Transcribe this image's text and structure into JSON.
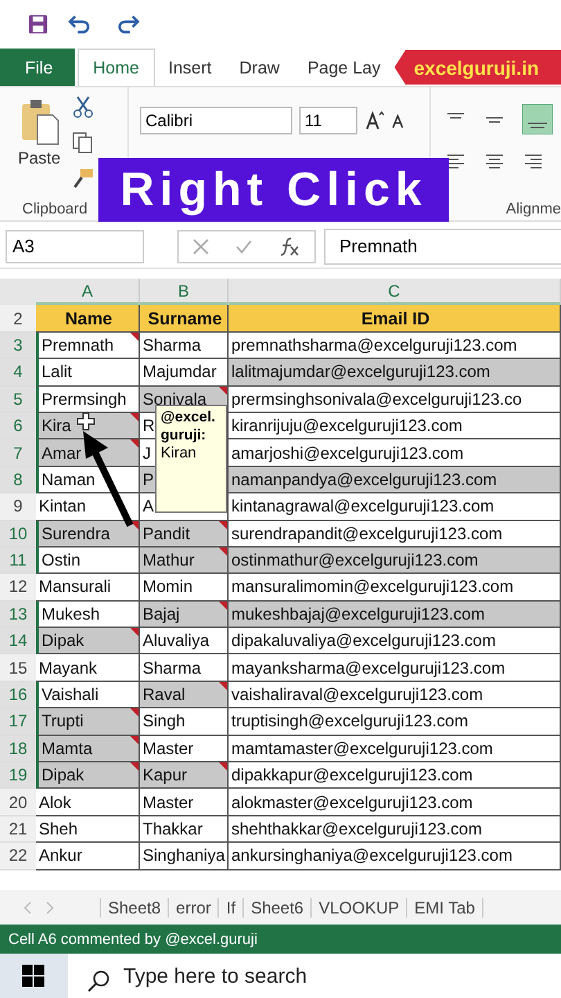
{
  "ribbon_tabs": [
    {
      "label": "File",
      "kind": "file",
      "selected": false
    },
    {
      "label": "Home",
      "kind": "tab",
      "selected": true
    },
    {
      "label": "Insert",
      "kind": "tab",
      "selected": false
    },
    {
      "label": "Draw",
      "kind": "tab",
      "selected": false
    },
    {
      "label": "Page Lay",
      "kind": "tab",
      "selected": false
    }
  ],
  "site_banner": "excelguruji.in",
  "title_banner": "Right Click",
  "ribbon": {
    "paste_label": "Paste",
    "font_name": "Calibri",
    "font_size": "11",
    "groups": [
      "Clipboard",
      "Alignme"
    ]
  },
  "name_box": "A3",
  "formula": "Premnath",
  "columns": [
    "A",
    "B",
    "C"
  ],
  "header_row": {
    "number": "2",
    "cells": [
      "Name",
      "Surname",
      "Email ID"
    ]
  },
  "rows": [
    {
      "number": "3",
      "selected": true,
      "cells": [
        {
          "text": "Premnath",
          "shaded": false,
          "comment": true
        },
        {
          "text": "Sharma",
          "shaded": false,
          "comment": false
        },
        {
          "text": "premnathsharma@excelguruji123.com",
          "shaded": false,
          "comment": false
        }
      ]
    },
    {
      "number": "4",
      "selected": true,
      "cells": [
        {
          "text": "Lalit",
          "shaded": false,
          "comment": false
        },
        {
          "text": "Majumdar",
          "shaded": false,
          "comment": false
        },
        {
          "text": "lalitmajumdar@excelguruji123.com",
          "shaded": true,
          "comment": false
        }
      ]
    },
    {
      "number": "5",
      "selected": true,
      "cells": [
        {
          "text": "Prermsingh",
          "shaded": false,
          "comment": false
        },
        {
          "text": "Sonivala",
          "shaded": true,
          "comment": true
        },
        {
          "text": "prermsinghsonivala@excelguruji123.co",
          "shaded": false,
          "comment": false
        }
      ]
    },
    {
      "number": "6",
      "selected": true,
      "cells": [
        {
          "text": "Kira",
          "shaded": true,
          "comment": true
        },
        {
          "text": "R",
          "shaded": false,
          "comment": false
        },
        {
          "text": "kiranrijuju@excelguruji123.com",
          "shaded": false,
          "comment": false
        }
      ]
    },
    {
      "number": "7",
      "selected": true,
      "cells": [
        {
          "text": "Amar",
          "shaded": true,
          "comment": true
        },
        {
          "text": "J",
          "shaded": false,
          "comment": false
        },
        {
          "text": "amarjoshi@excelguruji123.com",
          "shaded": false,
          "comment": false
        }
      ]
    },
    {
      "number": "8",
      "selected": true,
      "cells": [
        {
          "text": "Naman",
          "shaded": false,
          "comment": false
        },
        {
          "text": "P",
          "shaded": true,
          "comment": false
        },
        {
          "text": "namanpandya@excelguruji123.com",
          "shaded": true,
          "comment": false
        }
      ]
    },
    {
      "number": "9",
      "selected": false,
      "cells": [
        {
          "text": "Kintan",
          "shaded": false,
          "comment": false
        },
        {
          "text": "A",
          "shaded": false,
          "comment": false
        },
        {
          "text": "kintanagrawal@excelguruji123.com",
          "shaded": false,
          "comment": false
        }
      ]
    },
    {
      "number": "10",
      "selected": true,
      "cells": [
        {
          "text": "Surendra",
          "shaded": true,
          "comment": true
        },
        {
          "text": "Pandit",
          "shaded": true,
          "comment": true
        },
        {
          "text": "surendrapandit@excelguruji123.com",
          "shaded": false,
          "comment": false
        }
      ]
    },
    {
      "number": "11",
      "selected": true,
      "cells": [
        {
          "text": "Ostin",
          "shaded": false,
          "comment": false
        },
        {
          "text": "Mathur",
          "shaded": true,
          "comment": true
        },
        {
          "text": "ostinmathur@excelguruji123.com",
          "shaded": true,
          "comment": false
        }
      ]
    },
    {
      "number": "12",
      "selected": false,
      "cells": [
        {
          "text": "Mansurali",
          "shaded": false,
          "comment": false
        },
        {
          "text": "Momin",
          "shaded": false,
          "comment": false
        },
        {
          "text": "mansuralimomin@excelguruji123.com",
          "shaded": false,
          "comment": false
        }
      ]
    },
    {
      "number": "13",
      "selected": true,
      "cells": [
        {
          "text": "Mukesh",
          "shaded": false,
          "comment": false
        },
        {
          "text": "Bajaj",
          "shaded": true,
          "comment": true
        },
        {
          "text": "mukeshbajaj@excelguruji123.com",
          "shaded": true,
          "comment": false
        }
      ]
    },
    {
      "number": "14",
      "selected": true,
      "cells": [
        {
          "text": "Dipak",
          "shaded": true,
          "comment": true
        },
        {
          "text": "Aluvaliya",
          "shaded": false,
          "comment": false
        },
        {
          "text": "dipakaluvaliya@excelguruji123.com",
          "shaded": false,
          "comment": false
        }
      ]
    },
    {
      "number": "15",
      "selected": false,
      "cells": [
        {
          "text": "Mayank",
          "shaded": false,
          "comment": false
        },
        {
          "text": "Sharma",
          "shaded": false,
          "comment": false
        },
        {
          "text": "mayanksharma@excelguruji123.com",
          "shaded": false,
          "comment": false
        }
      ]
    },
    {
      "number": "16",
      "selected": true,
      "cells": [
        {
          "text": "Vaishali",
          "shaded": false,
          "comment": false
        },
        {
          "text": "Raval",
          "shaded": true,
          "comment": true
        },
        {
          "text": "vaishaliraval@excelguruji123.com",
          "shaded": false,
          "comment": false
        }
      ]
    },
    {
      "number": "17",
      "selected": true,
      "cells": [
        {
          "text": "Trupti",
          "shaded": true,
          "comment": true
        },
        {
          "text": "Singh",
          "shaded": false,
          "comment": false
        },
        {
          "text": "truptisingh@excelguruji123.com",
          "shaded": false,
          "comment": false
        }
      ]
    },
    {
      "number": "18",
      "selected": true,
      "cells": [
        {
          "text": "Mamta",
          "shaded": true,
          "comment": true
        },
        {
          "text": "Master",
          "shaded": false,
          "comment": false
        },
        {
          "text": "mamtamaster@excelguruji123.com",
          "shaded": false,
          "comment": false
        }
      ]
    },
    {
      "number": "19",
      "selected": true,
      "cells": [
        {
          "text": "Dipak",
          "shaded": true,
          "comment": true
        },
        {
          "text": "Kapur",
          "shaded": true,
          "comment": true
        },
        {
          "text": "dipakkapur@excelguruji123.com",
          "shaded": false,
          "comment": false
        }
      ]
    },
    {
      "number": "20",
      "selected": false,
      "cells": [
        {
          "text": "Alok",
          "shaded": false,
          "comment": false
        },
        {
          "text": "Master",
          "shaded": false,
          "comment": false
        },
        {
          "text": "alokmaster@excelguruji123.com",
          "shaded": false,
          "comment": false
        }
      ]
    },
    {
      "number": "21",
      "selected": false,
      "cells": [
        {
          "text": "Sheh",
          "shaded": false,
          "comment": false
        },
        {
          "text": "Thakkar",
          "shaded": false,
          "comment": false
        },
        {
          "text": "shehthakkar@excelguruji123.com",
          "shaded": false,
          "comment": false
        }
      ]
    },
    {
      "number": "22",
      "selected": false,
      "cells": [
        {
          "text": "Ankur",
          "shaded": false,
          "comment": false
        },
        {
          "text": "Singhaniya",
          "shaded": false,
          "comment": false
        },
        {
          "text": "ankursinghaniya@excelguruji123.com",
          "shaded": false,
          "comment": false
        }
      ]
    }
  ],
  "comment_tooltip": {
    "author": "@excel. guruji:",
    "text": "Kiran"
  },
  "sheet_tabs": [
    "Sheet8",
    "error",
    "If",
    "Sheet6",
    "VLOOKUP",
    "EMI Tab"
  ],
  "status": "Cell A6 commented by @excel.guruji",
  "taskbar_search": {
    "placeholder": "Type here to search"
  }
}
